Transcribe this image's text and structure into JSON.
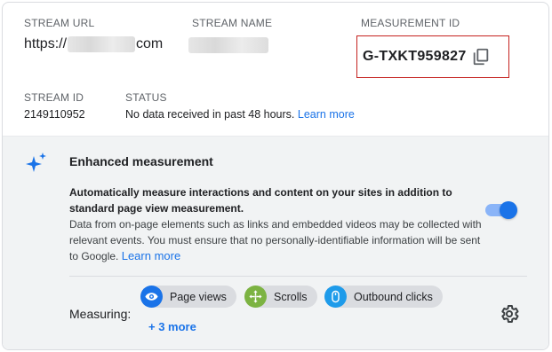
{
  "stream": {
    "url_label": "STREAM URL",
    "url_prefix": "https://",
    "url_suffix": "com",
    "name_label": "STREAM NAME",
    "measurement_id_label": "MEASUREMENT ID",
    "measurement_id": "G-TXKT959827",
    "stream_id_label": "STREAM ID",
    "stream_id": "2149110952",
    "status_label": "STATUS",
    "status_text": "No data received in past 48 hours.",
    "status_link": "Learn more"
  },
  "enhanced": {
    "title": "Enhanced measurement",
    "desc_bold": "Automatically measure interactions and content on your sites in addition to standard page view measurement.",
    "desc_body": "Data from on-page elements such as links and embedded videos may be collected with relevant events. You must ensure that no personally-identifiable information will be sent to Google.",
    "learn_more": "Learn more",
    "toggle_on": true,
    "measuring_label": "Measuring:",
    "chips": [
      {
        "label": "Page views",
        "icon": "eye-icon",
        "color": "#1a73e8"
      },
      {
        "label": "Scrolls",
        "icon": "move-arrows-icon",
        "color": "#7cb342"
      },
      {
        "label": "Outbound clicks",
        "icon": "mouse-icon",
        "color": "#1e9bea"
      }
    ],
    "more_link": "+ 3 more"
  },
  "colors": {
    "accent": "#1a73e8",
    "highlight_border": "#c5221f",
    "section_bg": "#f1f3f4"
  }
}
